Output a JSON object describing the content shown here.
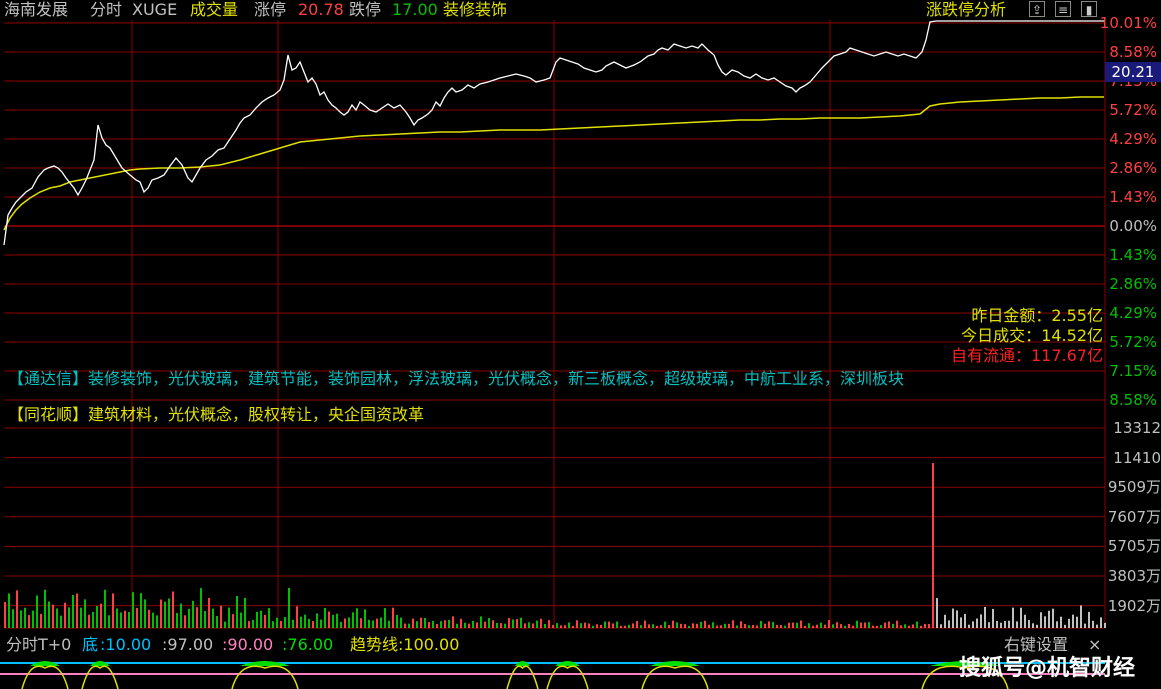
{
  "header": {
    "stock_name": "海南发展",
    "view": "分时",
    "indicator": "XUGE",
    "volume_label": "成交量",
    "limit_up_label": "涨停",
    "limit_up_value": "20.78",
    "limit_down_label": "跌停",
    "limit_down_value": "17.00",
    "industry": "装修装饰",
    "analysis_label": "涨跌停分析",
    "icons": [
      "arrow-up-icon",
      "list-icon",
      "panel-icon"
    ]
  },
  "price_axis": {
    "labels_up": [
      "10.01%",
      "8.58%",
      "7.15%",
      "5.72%",
      "4.29%",
      "2.86%",
      "1.43%"
    ],
    "label_zero": "0.00%",
    "labels_down": [
      "1.43%",
      "2.86%",
      "4.29%",
      "5.72%",
      "7.15%",
      "8.58%"
    ],
    "current_price": "20.21"
  },
  "stats": {
    "yesterday_amount_label": "昨日金额：",
    "yesterday_amount": "2.55亿",
    "today_turnover_label": "今日成交：",
    "today_turnover": "14.52亿",
    "free_float_label": "自有流通：",
    "free_float": "117.67亿"
  },
  "concepts": {
    "tdx": "【通达信】装修装饰，光伏玻璃，建筑节能，装饰园林，浮法玻璃，光伏概念，新三板概念，超级玻璃，中航工业系，深圳板块",
    "ths": "【同花顺】建筑材料，光伏概念，股权转让，央企国资改革"
  },
  "volume_axis": {
    "labels": [
      "13312",
      "11410",
      "9509万",
      "7607万",
      "5705万",
      "3803万",
      "1902万"
    ]
  },
  "indicator_bar": {
    "name": "分时T+0",
    "bottom_label": "底",
    "bottom_value": ":10.00",
    "v97": ":97.00",
    "v90": ":90.00",
    "v76": ":76.00",
    "trend_label": "趋势线",
    "trend_value": ":100.00",
    "right_settings": "右键设置",
    "close": "×"
  },
  "watermark": "搜狐号@机智财经",
  "colors": {
    "grid": "#8b0000",
    "price_line": "#ffffff",
    "avg_line": "#e0e000",
    "up": "#ff4040",
    "down": "#00c000",
    "neutral": "#c0c0c0",
    "cyan": "#00c0c0",
    "yellow": "#e0e000"
  }
}
